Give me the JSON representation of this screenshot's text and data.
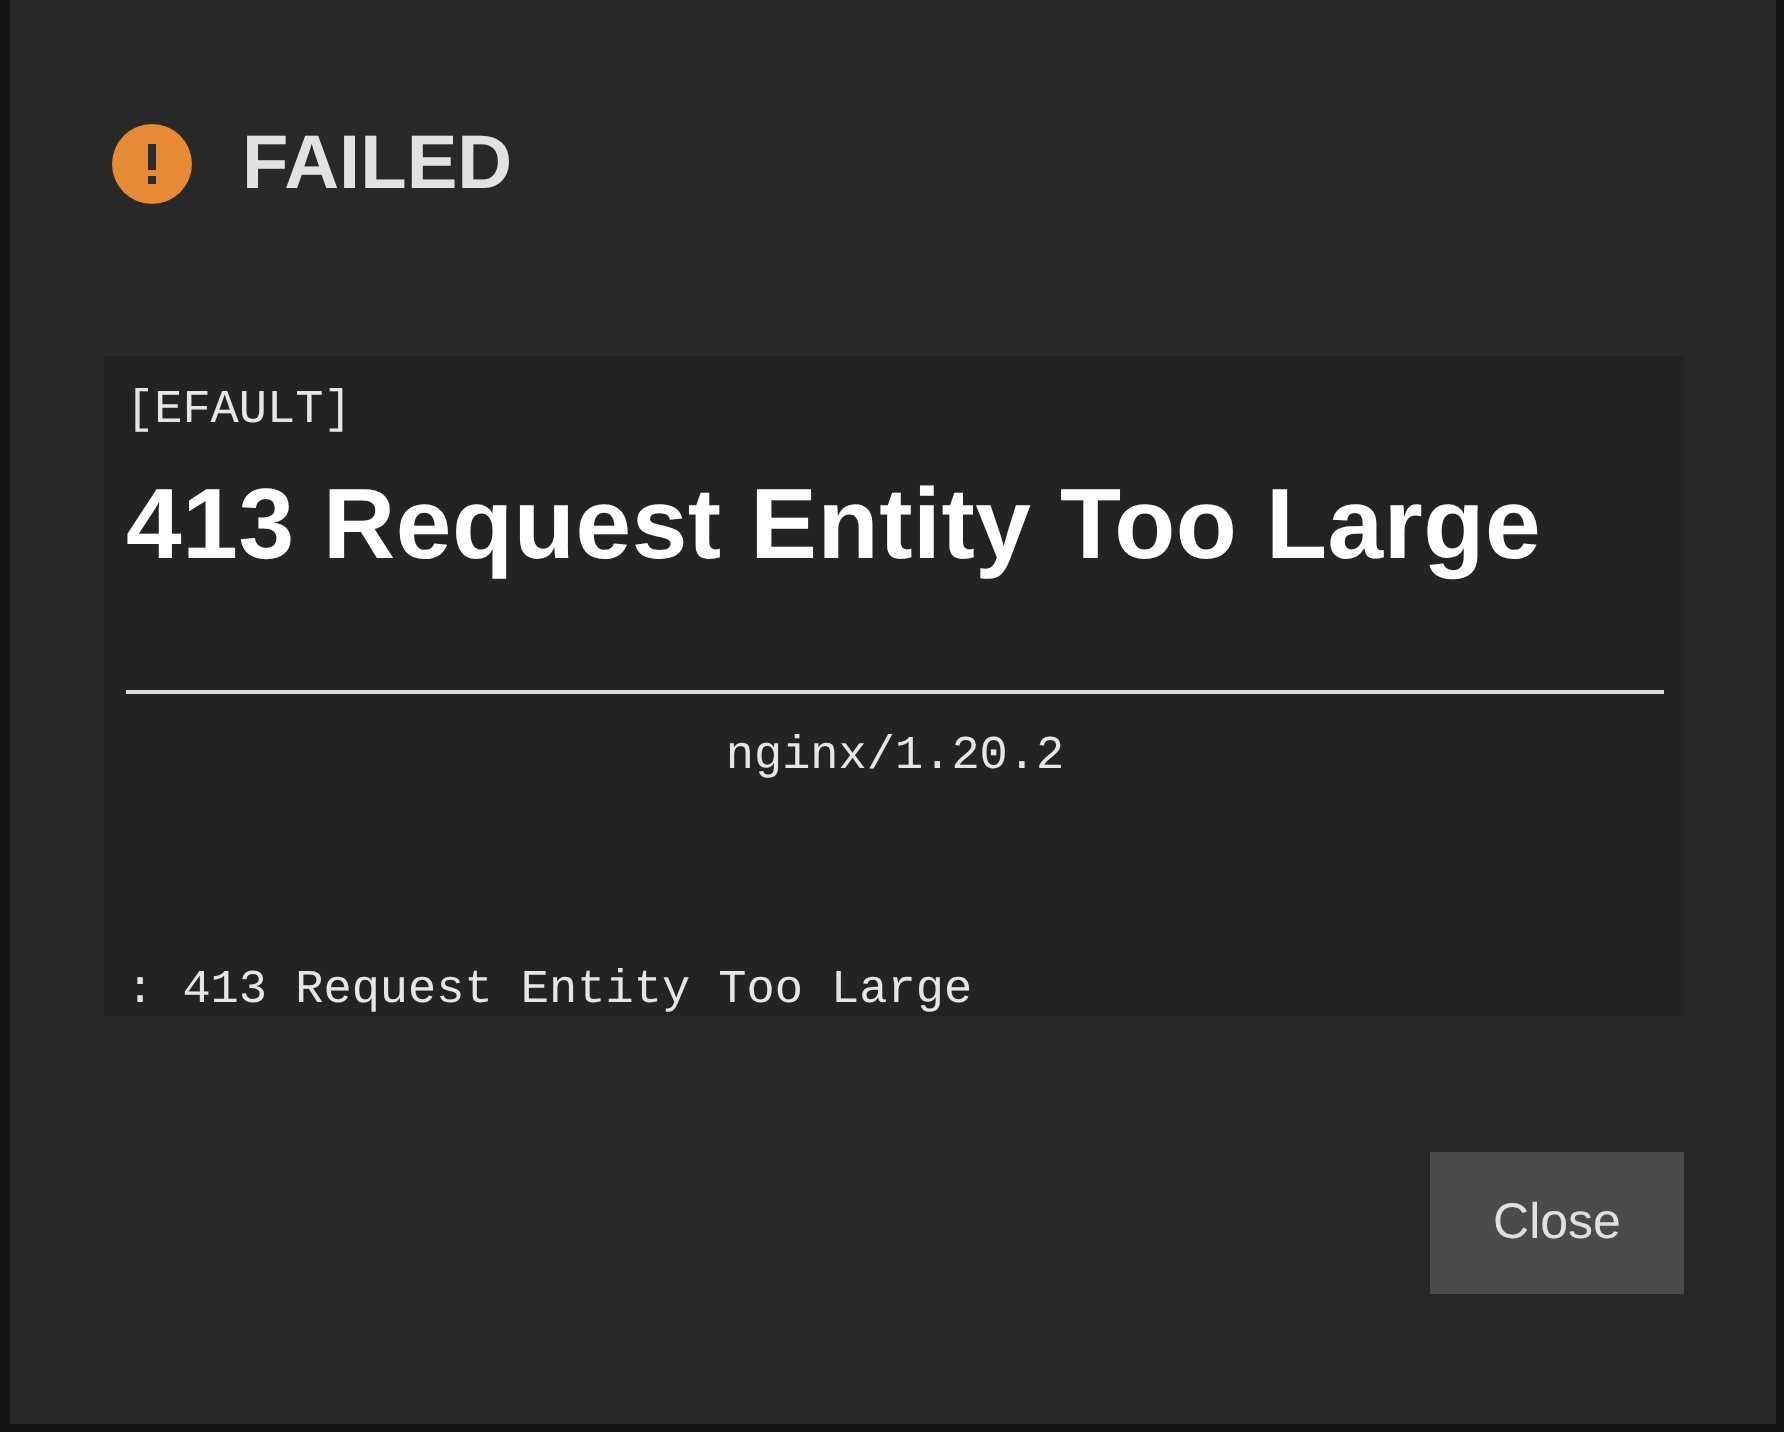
{
  "dialog": {
    "title": "FAILED",
    "error": {
      "code": "[EFAULT]",
      "heading": "413 Request Entity Too Large",
      "server": "nginx/1.20.2",
      "message": ": 413 Request Entity Too Large"
    },
    "buttons": [
      "Close"
    ]
  }
}
